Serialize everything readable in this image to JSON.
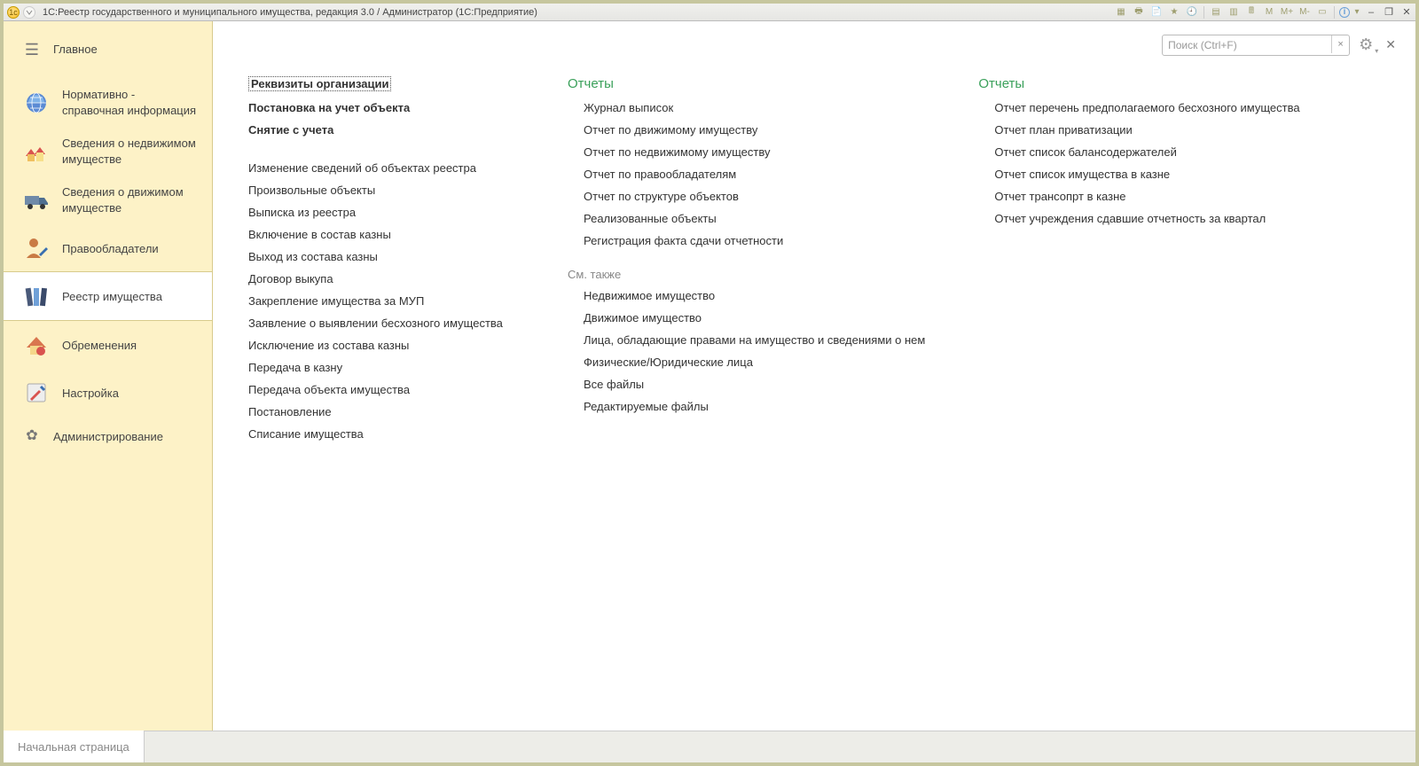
{
  "title": "1С:Реестр государственного и муниципального имущества, редакция 3.0 / Администратор  (1С:Предприятие)",
  "toolbar_letters": {
    "m": "M",
    "mplus": "M+",
    "mminus": "M-"
  },
  "search": {
    "placeholder": "Поиск (Ctrl+F)"
  },
  "sidebar": {
    "main": "Главное",
    "items": [
      "Нормативно - справочная информация",
      "Сведения о недвижимом имуществе",
      "Сведения о движимом имуществе",
      "Правообладатели",
      "Реестр имущества",
      "Обременения",
      "Настройка",
      "Администрирование"
    ]
  },
  "col1": {
    "h1": "Реквизиты организации",
    "h2": "Постановка на учет объекта",
    "h3": "Снятие с учета",
    "links": [
      "Изменение сведений об объектах реестра",
      "Произвольные объекты",
      "Выписка из реестра",
      "Включение в состав казны",
      "Выход из состава казны",
      "Договор выкупа",
      "Закрепление имущества за МУП",
      "Заявление о выявлении бесхозного имущества",
      "Исключение из состава казны",
      "Передача в казну",
      "Передача объекта имущества",
      "Постановление",
      "Списание имущества"
    ]
  },
  "col2": {
    "head": "Отчеты",
    "links": [
      "Журнал выписок",
      "Отчет по движимому имуществу",
      "Отчет по недвижимому имуществу",
      "Отчет по правообладателям",
      "Отчет по структуре объектов",
      "Реализованные объекты",
      "Регистрация факта сдачи отчетности"
    ],
    "sub": "См. также",
    "links2": [
      "Недвижимое имущество",
      "Движимое имущество",
      "Лица, обладающие правами на имущество и сведениями о нем",
      "Физические/Юридические лица",
      "Все файлы",
      "Редактируемые файлы"
    ]
  },
  "col3": {
    "head": "Отчеты",
    "links": [
      "Отчет перечень предполагаемого бесхозного имущества",
      "Отчет план приватизации",
      "Отчет список балансодержателей",
      "Отчет список имущества в казне",
      "Отчет трансопрт в казне",
      "Отчет учреждения сдавшие отчетность за квартал"
    ]
  },
  "bottom_tab": "Начальная страница"
}
